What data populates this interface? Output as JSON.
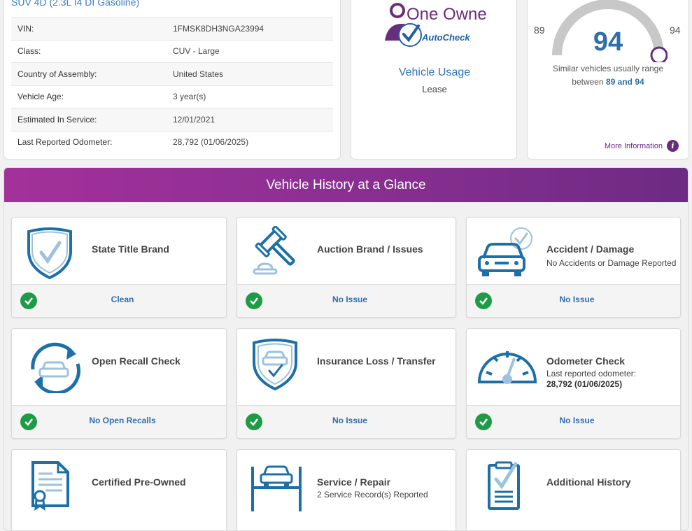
{
  "specs": {
    "vehicle_line": "SUV 4D (2.3L I4 DI Gasoline)",
    "rows": [
      {
        "label": "VIN:",
        "value": "1FMSK8DH3NGA23994"
      },
      {
        "label": "Class:",
        "value": "CUV - Large"
      },
      {
        "label": "Country of Assembly:",
        "value": "United States"
      },
      {
        "label": "Vehicle Age:",
        "value": "3 year(s)"
      },
      {
        "label": "Estimated In Service:",
        "value": "12/01/2021"
      },
      {
        "label": "Last Reported Odometer:",
        "value": "28,792 (01/06/2025)"
      }
    ]
  },
  "usage": {
    "badge_title": "One Owner",
    "badge_brand": "AutoCheck",
    "title": "Vehicle Usage",
    "value": "Lease"
  },
  "score": {
    "value": "94",
    "range_min": "89",
    "range_max": "94",
    "text_prefix": "Similar vehicles usually range",
    "text_between": "between",
    "text_range": "89 and 94",
    "more_info": "More Information",
    "info_icon": "i",
    "gauge_fraction": 1.0
  },
  "glance": {
    "title": "Vehicle History at a Glance",
    "cards": [
      {
        "title": "State Title Brand",
        "sub": "",
        "sub2": "",
        "status": "Clean",
        "icon": "shield-check-icon"
      },
      {
        "title": "Auction Brand / Issues",
        "sub": "",
        "sub2": "",
        "status": "No Issue",
        "icon": "gavel-icon"
      },
      {
        "title": "Accident / Damage",
        "sub": "No Accidents or Damage Reported",
        "sub2": "",
        "status": "No Issue",
        "icon": "car-check-icon"
      },
      {
        "title": "Open Recall Check",
        "sub": "",
        "sub2": "",
        "status": "No Open Recalls",
        "icon": "recall-cycle-icon"
      },
      {
        "title": "Insurance Loss / Transfer",
        "sub": "",
        "sub2": "",
        "status": "No Issue",
        "icon": "insurance-shield-icon"
      },
      {
        "title": "Odometer Check",
        "sub": "Last reported odometer:",
        "sub2": "28,792 (01/06/2025)",
        "status": "No Issue",
        "icon": "odometer-icon"
      },
      {
        "title": "Certified Pre-Owned",
        "sub": "",
        "sub2": "",
        "status": "",
        "icon": "certificate-icon"
      },
      {
        "title": "Service / Repair",
        "sub": "2 Service Record(s) Reported",
        "sub2": "",
        "status": "",
        "icon": "car-lift-icon"
      },
      {
        "title": "Additional History",
        "sub": "",
        "sub2": "",
        "status": "",
        "icon": "clipboard-check-icon"
      }
    ]
  },
  "colors": {
    "accent_blue": "#2e6db0",
    "purple": "#6a2c7c",
    "check_green": "#1f9b47",
    "icon_blue": "#1d6fa8",
    "icon_light": "#9cc2df"
  }
}
